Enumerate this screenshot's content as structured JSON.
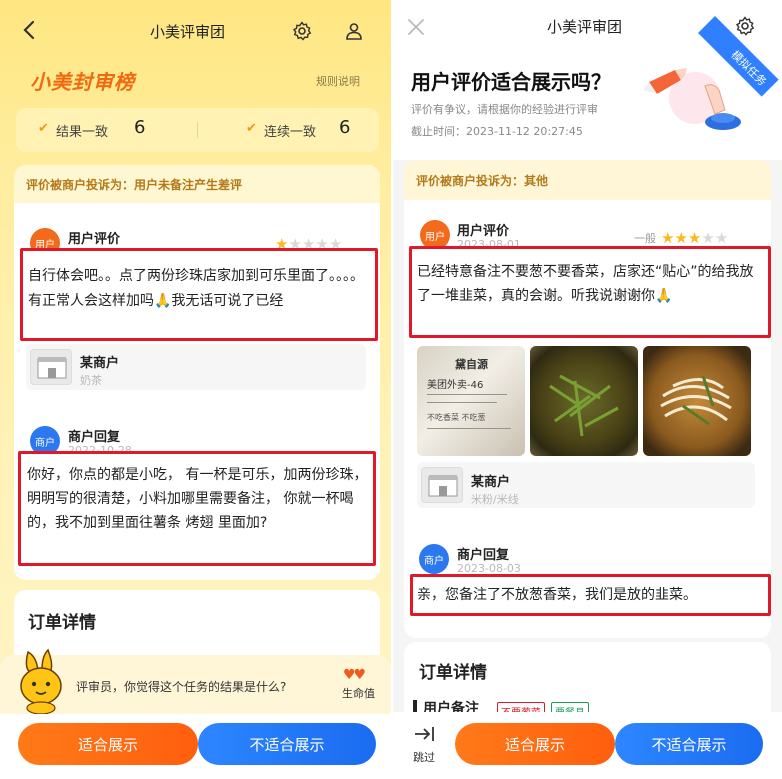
{
  "left": {
    "nav_title": "小美评审团",
    "header_title": "小美封审榜",
    "rules_link": "规则说明",
    "stats": [
      {
        "label": "结果一致",
        "value": "6"
      },
      {
        "label": "连续一致",
        "value": "6"
      }
    ],
    "complaint": "评价被商户投诉为：用户未备注产生差评",
    "user_section_label": "用户评价",
    "user_badge": "用户",
    "user_date": "2022-10-27",
    "user_rating": 1,
    "user_review": "自行体会吧。。点了两份珍珠店家加到可乐里面了。。。。有正常人会这样加吗🙏我无话可说了已经",
    "merchant_name": "某商户",
    "merchant_category": "奶茶",
    "reply_section_label": "商户回复",
    "reply_badge": "商户",
    "reply_date": "2022-10-28",
    "reply_text": "你好，你点的都是小吃， 有一杯是可乐，加两份珍珠， 明明写的很清楚，小料加哪里需要备注， 你就一杯喝的，我不加到里面往薯条 烤翅 里面加?",
    "order_title": "订单详情",
    "mascot_prompt": "评审员，你觉得这个任务的结果是什么?",
    "life_label": "生命值",
    "btn_suitable": "适合展示",
    "btn_unsuitable": "不适合展示"
  },
  "right": {
    "nav_title": "小美评审团",
    "ribbon": "模拟任务",
    "question": "用户评价适合展示吗？",
    "subtitle": "评价有争议，请根据你的经验进行评审",
    "deadline": "截止时间：2023-11-12 20:27:45",
    "complaint": "评价被商户投诉为：其他",
    "user_section_label": "用户评价",
    "user_badge": "用户",
    "user_date": "2023-08-01",
    "rating_word": "一般",
    "user_rating": 3,
    "user_review": "已经特意备注不要葱不要香菜，店家还“贴心”的给我放了一堆韭菜，真的会谢。听我说谢谢你🙏",
    "receipt_title": "黛自源",
    "receipt_line": "美团外卖-46",
    "receipt_note": "不吃香菜 不吃葱",
    "merchant_name": "某商户",
    "merchant_category": "米粉/米线",
    "reply_section_label": "商户回复",
    "reply_badge": "商户",
    "reply_date": "2023-08-03",
    "reply_text": "亲，您备注了不放葱香菜，我们是放的韭菜。",
    "order_title": "订单详情",
    "user_note_label": "用户备注",
    "tag_red": "不要葱菜",
    "tag_green": "要餐具",
    "skip_label": "跳过",
    "btn_suitable": "适合展示",
    "btn_unsuitable": "不适合展示"
  },
  "colors": {
    "accent_orange": "#f26a1b",
    "accent_blue": "#2c78f0",
    "highlight_red": "#e0192a",
    "star": "#ffb71a"
  }
}
